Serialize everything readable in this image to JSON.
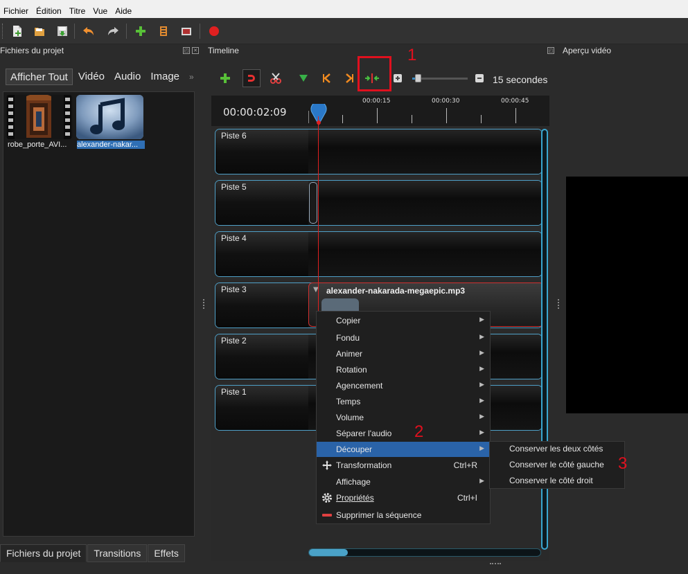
{
  "menubar": {
    "items": [
      "Fichier",
      "Édition",
      "Titre",
      "Vue",
      "Aide"
    ]
  },
  "icons": {
    "toolbar": [
      "new-project-icon",
      "open-project-icon",
      "save-project-icon",
      "undo-icon",
      "redo-icon",
      "import-files-icon",
      "profile-icon",
      "fullscreen-icon",
      "export-video-icon"
    ],
    "timeline_toolbar": [
      "add-track-icon",
      "snap-magnet-icon",
      "razor-icon",
      "add-marker-icon",
      "previous-marker-icon",
      "next-marker-icon",
      "center-playhead-icon",
      "zoom-out-icon",
      "zoom-in-icon"
    ]
  },
  "colors": {
    "accent_blue": "#2a63a8",
    "track_border": "#4fa0c8",
    "playhead": "#e02020",
    "annotation_red": "#e0101e"
  },
  "left_panel": {
    "title": "Fichiers du projet",
    "filters": [
      "Afficher Tout",
      "Vidéo",
      "Audio",
      "Image"
    ],
    "more": "»",
    "files": [
      {
        "label": "robe_porte_AVI...",
        "selected": false
      },
      {
        "label": "alexander-nakar...",
        "selected": true
      }
    ],
    "bottom_tabs": [
      "Fichiers du projet",
      "Transitions",
      "Effets"
    ]
  },
  "timeline": {
    "title": "Timeline",
    "zoom_label": "15 secondes",
    "zoom_level": 0.1,
    "time_readout": "00:00:02:09",
    "ruler": [
      "00:00:15",
      "00:00:30",
      "00:00:45"
    ],
    "tracks": [
      "Piste 6",
      "Piste 5",
      "Piste 4",
      "Piste 3",
      "Piste 2",
      "Piste 1"
    ],
    "clip": {
      "title": "alexander-nakarada-megaepic.mp3"
    }
  },
  "preview": {
    "title": "Aperçu vidéo"
  },
  "annotations": [
    "1",
    "2",
    "3"
  ],
  "context_menu": {
    "items": [
      {
        "label": "Copier",
        "submenu": true
      },
      {
        "label": "Fondu",
        "submenu": true
      },
      {
        "label": "Animer",
        "submenu": true
      },
      {
        "label": "Rotation",
        "submenu": true
      },
      {
        "label": "Agencement",
        "submenu": true
      },
      {
        "label": "Temps",
        "submenu": true
      },
      {
        "label": "Volume",
        "submenu": true
      },
      {
        "label": "Séparer l'audio",
        "submenu": true
      },
      {
        "label": "Découper",
        "submenu": true,
        "highlighted": true
      },
      {
        "label": "Transformation",
        "shortcut": "Ctrl+R"
      },
      {
        "label": "Affichage",
        "submenu": true
      },
      {
        "label": "Propriétés",
        "shortcut": "Ctrl+I"
      },
      {
        "label": "Supprimer la séquence"
      }
    ],
    "submenu_arrow": "▶",
    "submenu_items": [
      "Conserver les deux côtés",
      "Conserver le côté gauche",
      "Conserver le côté droit"
    ]
  }
}
